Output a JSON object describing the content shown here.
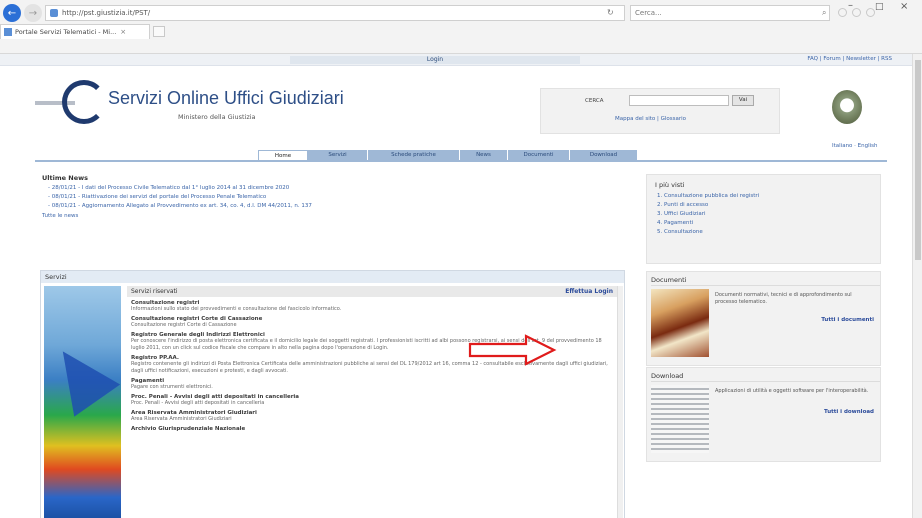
{
  "browser": {
    "url": "http://pst.giustizia.it/PST/",
    "search_placeholder": "Cerca...",
    "tab_title": "Portale Servizi Telematici - Mi...",
    "tab_close": "×",
    "back_glyph": "←",
    "fwd_glyph": "→",
    "refresh_glyph": "↻",
    "search_glyph": "⌕",
    "min_glyph": "–",
    "max_glyph": "□",
    "close_glyph": "×"
  },
  "topbar": {
    "login": "Login",
    "util_links": "FAQ | Forum | Newsletter | RSS"
  },
  "header": {
    "title": "Servizi Online Uffici Giudiziari",
    "subtitle": "Ministero della Giustizia",
    "cerca_label": "CERCA",
    "vai": "Vai",
    "cerca_links": "Mappa del sito | Glossario",
    "lang_links": "Italiano · English"
  },
  "nav": [
    {
      "label": "Home",
      "active": true,
      "w": 50
    },
    {
      "label": "Servizi",
      "active": false,
      "w": 60
    },
    {
      "label": "Schede pratiche",
      "active": false,
      "w": 92
    },
    {
      "label": "News",
      "active": false,
      "w": 48
    },
    {
      "label": "Documenti",
      "active": false,
      "w": 62
    },
    {
      "label": "Download",
      "active": false,
      "w": 68
    }
  ],
  "news": {
    "title": "Ultime News",
    "items": [
      "- 28/01/21 - I dati del Processo Civile Telematico dal 1° luglio 2014 al 31 dicembre 2020",
      "- 08/01/21 - Riattivazione dei servizi del portale del Processo Penale Telematico",
      "- 08/01/21 - Aggiornamento Allegato al Provvedimento ex art. 34, co. 4, d.l. DM 44/2011, n. 137"
    ],
    "all": "Tutte le news"
  },
  "servizi": {
    "header": "Servizi",
    "riservati": "Servizi riservati",
    "login": "Effettua Login",
    "items": [
      {
        "title": "Consultazione registri",
        "desc": "Informazioni sullo stato dei provvedimenti e consultazione del fascicolo informatico."
      },
      {
        "title": "Consultazione registri Corte di Cassazione",
        "desc": "Consultazione registri Corte di Cassazione"
      },
      {
        "title": "Registro Generale degli Indirizzi Elettronici",
        "desc": "Per conoscere l'indirizzo di posta elettronica certificata e il domicilio legale dei soggetti registrati. I professionisti iscritti ad albi possono registrarsi, ai sensi dell'art. 9 del provvedimento 18 luglio 2011, con un click sul codice fiscale che compare in alto nella pagina dopo l'operazione di Login."
      },
      {
        "title": "Registro PP.AA.",
        "desc": "Registro contenente gli indirizzi di Posta Elettronica Certificata delle amministrazioni pubbliche ai sensi del DL 179/2012 art 16, comma 12 - consultabile esclusivamente dagli uffici giudiziari, dagli uffici notificazioni, esecuzioni e protesti, e dagli avvocati."
      },
      {
        "title": "Pagamenti",
        "desc": "Pagare con strumenti elettronici."
      },
      {
        "title": "Proc. Penali - Avvisi degli atti depositati in cancelleria",
        "desc": "Proc. Penali - Avvisi degli atti depositati in cancelleria"
      },
      {
        "title": "Area Riservata Amministratori Giudiziari",
        "desc": "Area Riservata Amministratori Giudiziari"
      },
      {
        "title": "Archivio Giurisprudenziale Nazionale",
        "desc": ""
      }
    ]
  },
  "piu_visti": {
    "title": "I più visti",
    "items": [
      "1. Consultazione pubblica dei registri",
      "2. Punti di accesso",
      "3. Uffici Giudiziari",
      "4. Pagamenti",
      "5. Consultazione"
    ]
  },
  "documenti": {
    "title": "Documenti",
    "text": "Documenti normativi, tecnici e di approfondimento sul processo telematico.",
    "link": "Tutti i documenti"
  },
  "download": {
    "title": "Download",
    "text": "Applicazioni di utilità e oggetti software per l'interoperabilità.",
    "link": "Tutti i download"
  },
  "colors": {
    "brand_blue": "#2e4f87",
    "nav_blue": "#9fb8d6",
    "link_blue": "#3a64a8",
    "annotation_red": "#e01b1b"
  }
}
